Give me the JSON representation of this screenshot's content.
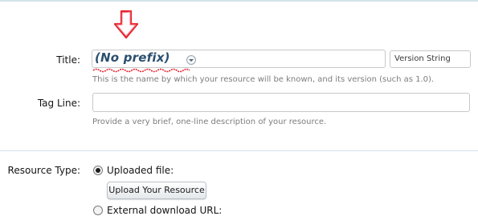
{
  "title_field": {
    "label": "Title:",
    "prefix_value": "(No prefix)",
    "version_placeholder": "Version String",
    "hint": "This is the name by which your resource will be known, and its version (such as 1.0)."
  },
  "tagline_field": {
    "label": "Tag Line:",
    "hint": "Provide a very brief, one-line description of your resource."
  },
  "resource_type": {
    "label": "Resource Type:",
    "options": [
      {
        "label": "Uploaded file:",
        "selected": true
      },
      {
        "label": "External download URL:",
        "selected": false
      }
    ],
    "upload_button": "Upload Your Resource"
  },
  "colors": {
    "arrow_annotation": "#e8222f",
    "prefix_text": "#2b4f6e",
    "divider": "#d3e3ea"
  }
}
